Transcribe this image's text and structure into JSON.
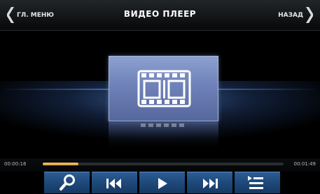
{
  "header": {
    "title": "ВИДЕО ПЛЕЕР",
    "left_button_label": "ГЛ. МЕНЮ",
    "right_button_label": "НАЗАД"
  },
  "player": {
    "time_elapsed": "00:00:16",
    "time_total": "00:01:49",
    "progress_fraction": 0.147,
    "accent_color": "#e8ad4a"
  },
  "controls": [
    {
      "icon": "search-icon"
    },
    {
      "icon": "previous-track-icon"
    },
    {
      "icon": "play-icon"
    },
    {
      "icon": "next-track-icon"
    },
    {
      "icon": "playlist-icon"
    }
  ],
  "video_placeholder": {
    "icon": "film-strip-icon"
  }
}
